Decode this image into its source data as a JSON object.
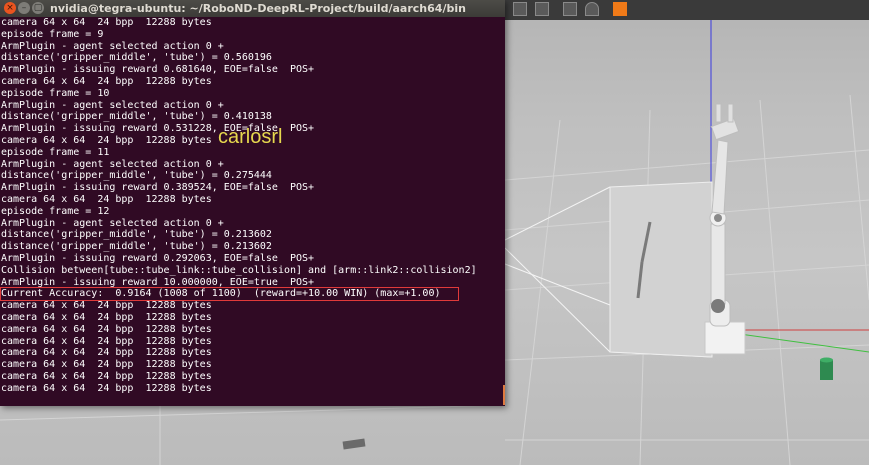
{
  "window": {
    "title": "nvidia@tegra-ubuntu: ~/RoboND-DeepRL-Project/build/aarch64/bin",
    "close_glyph": "×",
    "min_glyph": "–",
    "max_glyph": "▢"
  },
  "terminal": {
    "lines": [
      "camera 64 x 64  24 bpp  12288 bytes",
      "episode frame = 9",
      "ArmPlugin - agent selected action 0 +",
      "distance('gripper_middle', 'tube') = 0.560196",
      "ArmPlugin - issuing reward 0.681640, EOE=false  POS+",
      "camera 64 x 64  24 bpp  12288 bytes",
      "episode frame = 10",
      "ArmPlugin - agent selected action 0 +",
      "distance('gripper_middle', 'tube') = 0.410138",
      "ArmPlugin - issuing reward 0.531228, EOE=false  POS+",
      "camera 64 x 64  24 bpp  12288 bytes",
      "episode frame = 11",
      "ArmPlugin - agent selected action 0 +",
      "distance('gripper_middle', 'tube') = 0.275444",
      "ArmPlugin - issuing reward 0.389524, EOE=false  POS+",
      "camera 64 x 64  24 bpp  12288 bytes",
      "episode frame = 12",
      "ArmPlugin - agent selected action 0 +",
      "distance('gripper_middle', 'tube') = 0.213602",
      "distance('gripper_middle', 'tube') = 0.213602",
      "ArmPlugin - issuing reward 0.292063, EOE=false  POS+",
      "Collision between[tube::tube_link::tube_collision] and [arm::link2::collision2]",
      "ArmPlugin - issuing reward 10.000000, EOE=true  POS+",
      "Current Accuracy:  0.9164 (1008 of 1100)  (reward=+10.00 WIN) (max=+1.00)",
      "camera 64 x 64  24 bpp  12288 bytes",
      "camera 64 x 64  24 bpp  12288 bytes",
      "camera 64 x 64  24 bpp  12288 bytes",
      "camera 64 x 64  24 bpp  12288 bytes",
      "camera 64 x 64  24 bpp  12288 bytes",
      "camera 64 x 64  24 bpp  12288 bytes",
      "camera 64 x 64  24 bpp  12288 bytes",
      "camera 64 x 64  24 bpp  12288 bytes"
    ],
    "highlighted_line_index": 23
  },
  "watermark": "carlosrl",
  "colors": {
    "terminal_bg": "#300a24",
    "terminal_text": "#ffffff",
    "highlight_border": "#e03a3a",
    "watermark": "#e6d84e",
    "close_button": "#e9541f",
    "tube": "#2e8a50"
  },
  "icons": {
    "toolbar": [
      "copy-icon",
      "paste-icon",
      "align-icon",
      "snap-icon",
      "shape-icon"
    ]
  }
}
